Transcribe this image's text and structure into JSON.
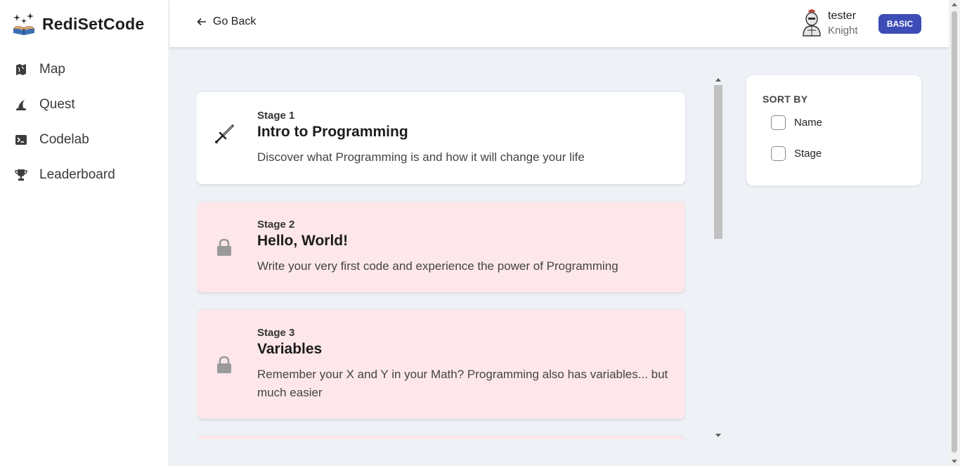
{
  "app": {
    "name": "RediSetCode",
    "logo_icon": "book-sparkle-icon"
  },
  "sidebar": {
    "items": [
      {
        "label": "Map",
        "icon": "map-icon"
      },
      {
        "label": "Quest",
        "icon": "wizard-hat-icon"
      },
      {
        "label": "Codelab",
        "icon": "terminal-icon"
      },
      {
        "label": "Leaderboard",
        "icon": "trophy-icon"
      }
    ]
  },
  "header": {
    "back_label": "Go Back",
    "user": {
      "name": "tester",
      "rank": "Knight",
      "avatar_icon": "knight-avatar-icon"
    },
    "plan_badge": "BASIC"
  },
  "stages": [
    {
      "number": "Stage 1",
      "title": "Intro to Programming",
      "description": "Discover what Programming is and how it will change your life",
      "status": "unlocked",
      "icon": "sword-icon"
    },
    {
      "number": "Stage 2",
      "title": "Hello, World!",
      "description": "Write your very first code and experience the power of Programming",
      "status": "locked",
      "icon": "lock-icon"
    },
    {
      "number": "Stage 3",
      "title": "Variables",
      "description": "Remember your X and Y in your Math? Programming also has variables... but much easier",
      "status": "locked",
      "icon": "lock-icon"
    }
  ],
  "sort": {
    "title": "SORT BY",
    "options": [
      {
        "label": "Name",
        "checked": false
      },
      {
        "label": "Stage",
        "checked": false
      }
    ]
  },
  "colors": {
    "badge": "#3d4db7",
    "locked_card": "#fde7ea",
    "page_bg": "#eef2f6"
  }
}
